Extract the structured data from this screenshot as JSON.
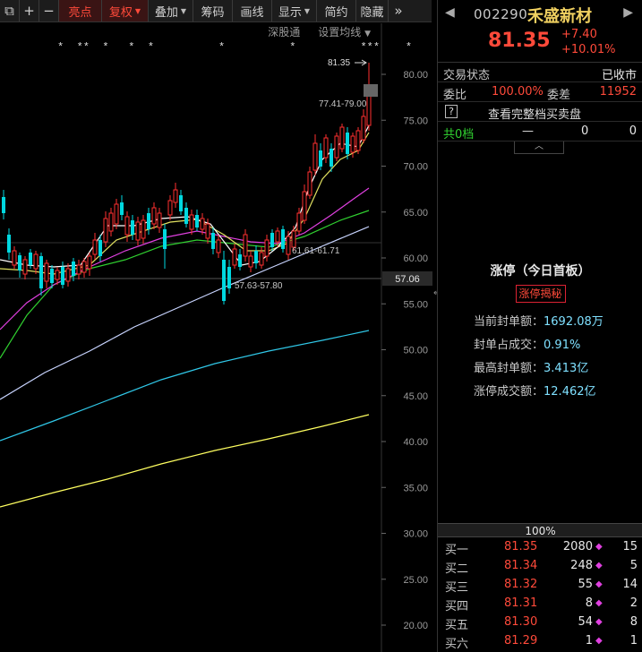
{
  "toolbar": {
    "buttons": [
      {
        "label": "亮点"
      },
      {
        "label": "复权"
      },
      {
        "label": "叠加"
      },
      {
        "label": "筹码"
      },
      {
        "label": "画线"
      },
      {
        "label": "显示"
      },
      {
        "label": "简约"
      },
      {
        "label": "隐藏"
      }
    ],
    "icons": [
      "restore-icon",
      "plus-icon",
      "minus-icon",
      "expand-icon"
    ],
    "icon_glyphs": {
      "restore": "⧉",
      "plus": "+",
      "minus": "−",
      "expand": "»"
    }
  },
  "subbar": {
    "market_link": "深股通",
    "ma_settings": "设置均线"
  },
  "chart": {
    "price_axis": [
      "80.00",
      "75.00",
      "70.00",
      "65.00",
      "60.00",
      "55.00",
      "50.00",
      "45.00",
      "40.00",
      "35.00",
      "30.00",
      "25.00",
      "20.00"
    ],
    "current_price_tag": "57.06",
    "annotations": {
      "high_label": "81.35",
      "range_top": "77.41-79.00",
      "range_mid": "61.61-61.71",
      "range_low": "57.63-57.80"
    },
    "star_marks": "*  **  *   *  *          *          *          ***    *    *"
  },
  "stock": {
    "code": "002290",
    "name": "禾盛新材",
    "price": "81.35",
    "change": "+7.40",
    "change_pct": "+10.01%",
    "status_label": "交易状态",
    "status_value": "已收市",
    "ratio_label": "委比",
    "ratio_value": "100.00%",
    "diff_label": "委差",
    "diff_value": "11952",
    "full_book_label": "查看完整档买卖盘",
    "levels_label": "共0档",
    "levels_dash": "—",
    "levels_v1": "0",
    "levels_v2": "0"
  },
  "limit_up": {
    "title": "涨停（今日首板）",
    "reveal_button": "涨停揭秘",
    "items": [
      {
        "label": "当前封单额：",
        "value": "1692.08万"
      },
      {
        "label": "封单占成交：",
        "value": "0.91%"
      },
      {
        "label": "最高封单额：",
        "value": "3.413亿"
      },
      {
        "label": "涨停成交额：",
        "value": "12.462亿"
      }
    ]
  },
  "order_book": {
    "pct": "100%",
    "bids": [
      {
        "label": "买一",
        "price": "81.35",
        "vol": "2080",
        "count": "15"
      },
      {
        "label": "买二",
        "price": "81.34",
        "vol": "248",
        "count": "5"
      },
      {
        "label": "买三",
        "price": "81.32",
        "vol": "55",
        "count": "14"
      },
      {
        "label": "买四",
        "price": "81.31",
        "vol": "8",
        "count": "2"
      },
      {
        "label": "买五",
        "price": "81.30",
        "vol": "54",
        "count": "8"
      },
      {
        "label": "买六",
        "price": "81.29",
        "vol": "1",
        "count": "1"
      }
    ]
  },
  "colors": {
    "up": "#ff3030",
    "down": "#00d8e0",
    "ma5": "#ffffff",
    "ma10": "#e0e060",
    "ma20": "#e040e0",
    "ma30": "#30d030",
    "ma60": "#9aa0ff",
    "ma120": "#30c8e8",
    "ma250": "#ffff60"
  }
}
